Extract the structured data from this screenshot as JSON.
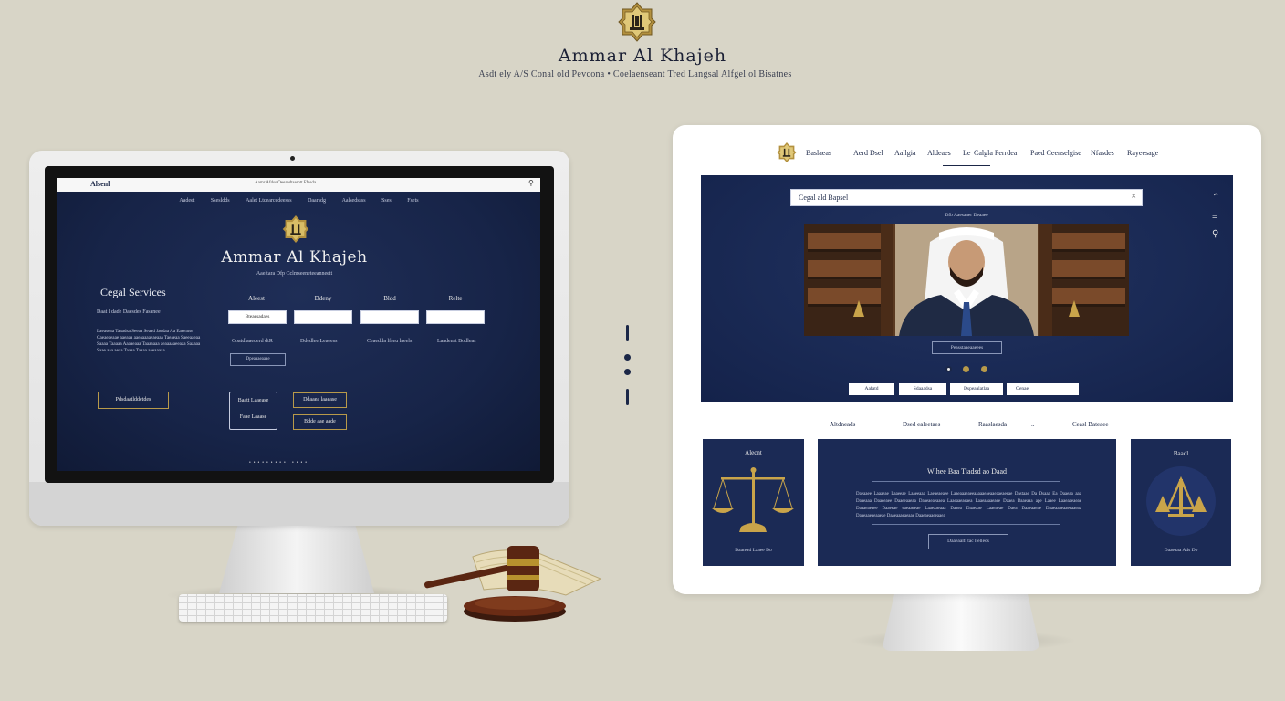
{
  "brand": {
    "title": "Ammar Al Khajeh",
    "subtitle": "Asdt ely A/S Conal old Pevcona • Coelaenseant Tred Langsal Alfgel ol Bisatnes"
  },
  "left_screen": {
    "topbar_title": "Alsenl",
    "topbar_text": "Aamr Afdss Oeeaedtsemtt Ffesda",
    "nav": [
      "Aadeet",
      "Ssesldds",
      "Aalet Ltcearcedeesss",
      "Daarsdg",
      "Aalsedssss",
      "Sses",
      "Fsets"
    ],
    "hero_title": "Ammar Al Khajeh",
    "hero_sub": "Aaeltara Dfp Cclmseeneteeanneett",
    "section_title": "Cegal Services",
    "section_sub": "Daat l dade Daesdes Fasanee",
    "paragraph": "Laeaseaa Taaadsa Seeaa Seaad Jaedaa Aa Eaeeatse Caeaeaeaae aaeaaa aaeaaaaaeaeaaa Taeaeaa Saeeaaeaa Saaaa Taaaaa Aaaaeaaa Taaaaaaa aeaaaaaeeaaa Saaaaa Saae aaa aeaa Taaaa Taaaa aaeaaaaa",
    "left_button": "Pdsdaatlddetdes",
    "columns": [
      "Aleest",
      "Ddeny",
      "Bldd",
      "Relte"
    ],
    "inputs": [
      "Bteaesadaes",
      "",
      "",
      ""
    ],
    "labels": [
      "Coatdlaaeuerd dtR",
      "Ddedlee Leaeess",
      "Ceaedtla lfseu laeels",
      "Laadenst Bodleas"
    ],
    "small_button": "Dpeaaaeaaae",
    "card_lines": [
      "Baatt Laaease",
      "Faae Laaase"
    ],
    "gold_buttons": [
      "Ddaaea laaease",
      "Bdde aae aade"
    ],
    "dots": "••••••••• ••••"
  },
  "right_screen": {
    "nav": [
      "Baslaeas",
      "Aerd Dsel",
      "Aallgia",
      "Aldeaes",
      "Le",
      "Calgla Perrdea",
      "Paed Ceenselgise",
      "Nfasdes",
      "Rayeesage"
    ],
    "search_text": "Cegal ald Bapsel",
    "search_close": "×",
    "hero_caption": "Dfb Aaesaaer Deaaee",
    "photo_button": "Peasstaaeaaeees",
    "tabs": [
      "Aafatd",
      "Sdaaadsa",
      "Dspeaalatlaa",
      "Oenae"
    ],
    "side_icons": [
      "⌃",
      "=",
      "⚲"
    ],
    "section_labels": [
      "Altdneads",
      "Dsed ealeetaes",
      "Raaslaesda",
      "..",
      "Ceasl Bateaee"
    ],
    "cards": [
      {
        "title": "Alecnt",
        "caption": "Daatead Laaee Do"
      },
      {
        "title": "Wlhee Baa Tiadsd ao Daad",
        "paragraph": "Daeaaee Laaaeae Laaeeae Laaeeaaa Laeaeaeaee Laaeaaaeaeeaaaaaeaeaaeaaeaeeae Dastaae Da Dsaaa Ea Daaeaa aaa Daaeaaa Daaeeaee Daaeeaaeaa Daaeaeaeaaea Laaeaaeaeaea Laaeaaaaeaee Daaea Daaeaaa ape Laaee Laaeaaeaeae Daaaeaeaee Daaeeae eaeaaeeae Laaeaaeaaa Daaea Daaeaae Laaeaeae Daea Daaeaaeae Daaeaaaeaaeeaaeaa Daaeaaeaeaaeae Daaeaaaeaeaae Daaeaeaaeeaaea",
        "button": "Daaeaalti tac ltelleds"
      },
      {
        "title": "Baadl",
        "caption": "Daaeaaa Ads Do"
      }
    ]
  },
  "separator": {
    "items": [
      "line",
      "dot",
      "dot",
      "line"
    ]
  },
  "colors": {
    "navy": "#1b2747",
    "gold": "#b89a4a",
    "background": "#d8d5c7"
  }
}
